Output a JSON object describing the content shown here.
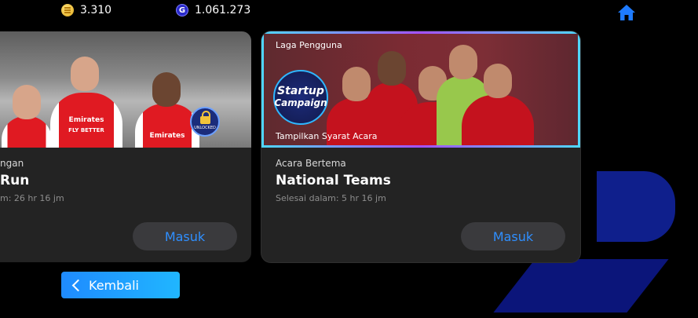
{
  "currency": {
    "coins": "3.310",
    "gp": "1.061.273",
    "gp_symbol": "G"
  },
  "cards": [
    {
      "type": "ngan",
      "title": "Run",
      "ends": "m: 26 hr 16 jm",
      "button": "Masuk",
      "sponsor_line1": "Emirates",
      "sponsor_line2": "FLY BETTER",
      "sponsor_line3": "Emirates",
      "lock_label": "UNLOCKED"
    },
    {
      "tag": "Laga Pengguna",
      "badge_line1": "Startup",
      "badge_line2": "Campaign",
      "conditions": "Tampilkan Syarat Acara",
      "type": "Acara Bertema",
      "title": "National Teams",
      "ends": "Selesai dalam: 5 hr 16 jm",
      "button": "Masuk"
    }
  ],
  "back_button": "Kembali",
  "colors": {
    "accent": "#2f8fff",
    "card_bg": "#232323",
    "back_button": "#1f8bff"
  },
  "icons": [
    "coin-icon",
    "gp-icon",
    "home-icon",
    "lock-icon",
    "chevron-left-icon"
  ]
}
